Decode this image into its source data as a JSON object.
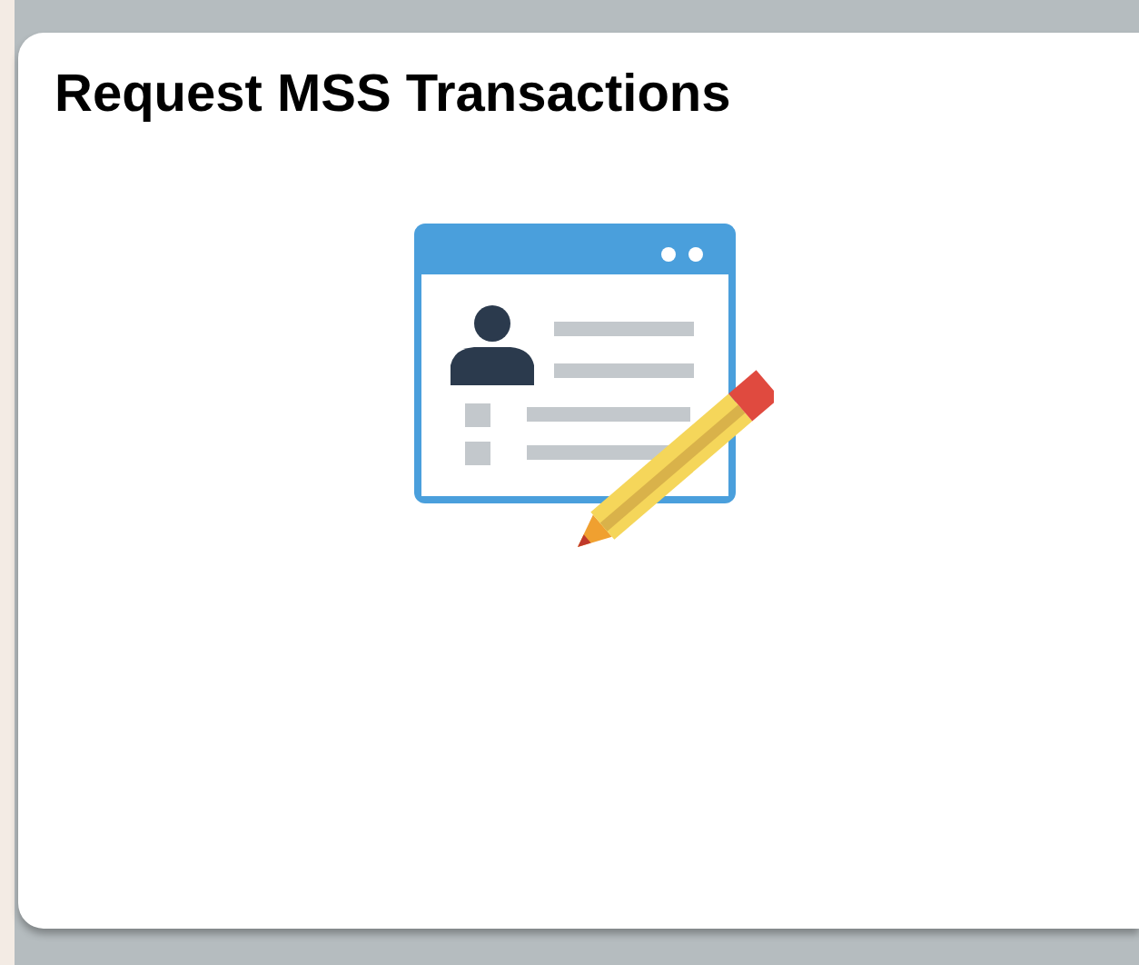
{
  "tile": {
    "title": "Request MSS Transactions"
  }
}
